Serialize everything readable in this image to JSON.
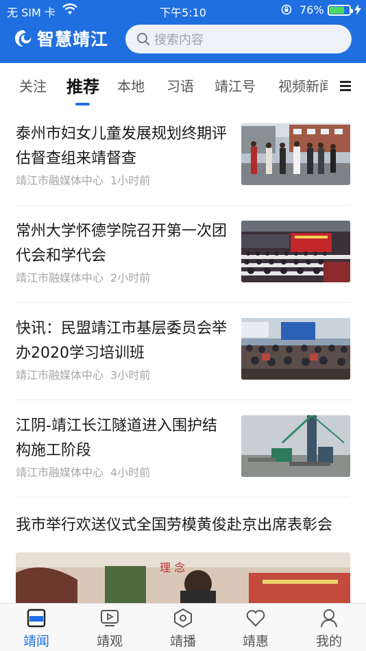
{
  "status_bar": {
    "carrier": "无 SIM 卡",
    "time": "下午5:10",
    "battery": "76%",
    "battery_level": 0.76
  },
  "header": {
    "app_name": "智慧靖江",
    "search_placeholder": "搜索内容"
  },
  "tabs": [
    "关注",
    "推荐",
    "本地",
    "习语",
    "靖江号",
    "视频新闻"
  ],
  "active_tab": "推荐",
  "news": [
    {
      "title": "泰州市妇女儿童发展规划终期评估督查组来靖督查",
      "source": "靖江市融媒体中心",
      "age": "1小时前"
    },
    {
      "title": "常州大学怀德学院召开第一次团代会和学代会",
      "source": "靖江市融媒体中心",
      "age": "2小时前"
    },
    {
      "title": "快讯：民盟靖江市基层委员会举办2020学习培训班",
      "source": "靖江市融媒体中心",
      "age": "3小时前"
    },
    {
      "title": "江阴-靖江长江隧道进入围护结构施工阶段",
      "source": "靖江市融媒体中心",
      "age": "4小时前"
    }
  ],
  "featured": {
    "title": "我市举行欢送仪式全国劳模黄俊赴京出席表彰会",
    "image_text": "理 念"
  },
  "bottom_nav": [
    "靖闻",
    "靖观",
    "靖播",
    "靖惠",
    "我的"
  ],
  "colors": {
    "brand": "#1f6fe0",
    "text": "#1a1a1a",
    "meta": "#a6a6a6",
    "nav_inactive": "#555555"
  }
}
